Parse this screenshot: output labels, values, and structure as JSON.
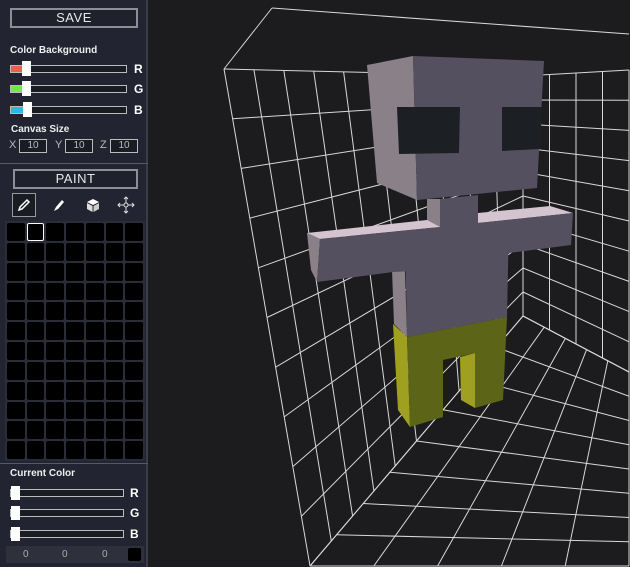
{
  "panel": {
    "save_label": "SAVE",
    "color_background_label": "Color Background",
    "bg_sliders": [
      {
        "channel": "R",
        "value": 0.1,
        "color": "#e8624a"
      },
      {
        "channel": "G",
        "value": 0.1,
        "color": "#6ee84a"
      },
      {
        "channel": "B",
        "value": 0.11,
        "color": "#2bb8e8"
      }
    ],
    "canvas_size_label": "Canvas Size",
    "canvas_size": {
      "x_label": "X",
      "x": "10",
      "y_label": "Y",
      "y": "10",
      "z_label": "Z",
      "z": "10"
    },
    "paint_label": "PAINT",
    "tools": [
      "pencil-icon",
      "eyedropper-icon",
      "cube-icon",
      "move-icon"
    ],
    "palette": {
      "columns": 7,
      "rows": 12,
      "selected_index": 1
    },
    "current_color_label": "Current Color",
    "current_sliders": [
      {
        "channel": "R",
        "value": 0
      },
      {
        "channel": "G",
        "value": 0
      },
      {
        "channel": "B",
        "value": 0
      }
    ],
    "current_values": [
      "0",
      "0",
      "0"
    ],
    "current_swatch": "#000000"
  },
  "scene": {
    "grid_color": "#d8d8d8",
    "background": "#1c1c1e",
    "body_colors": {
      "front": "#555060",
      "side": "#8a8088",
      "top": "#d4c4d0",
      "eyes": "#1c2024",
      "pants_front": "#5c6418",
      "pants_side": "#a0a020"
    }
  }
}
